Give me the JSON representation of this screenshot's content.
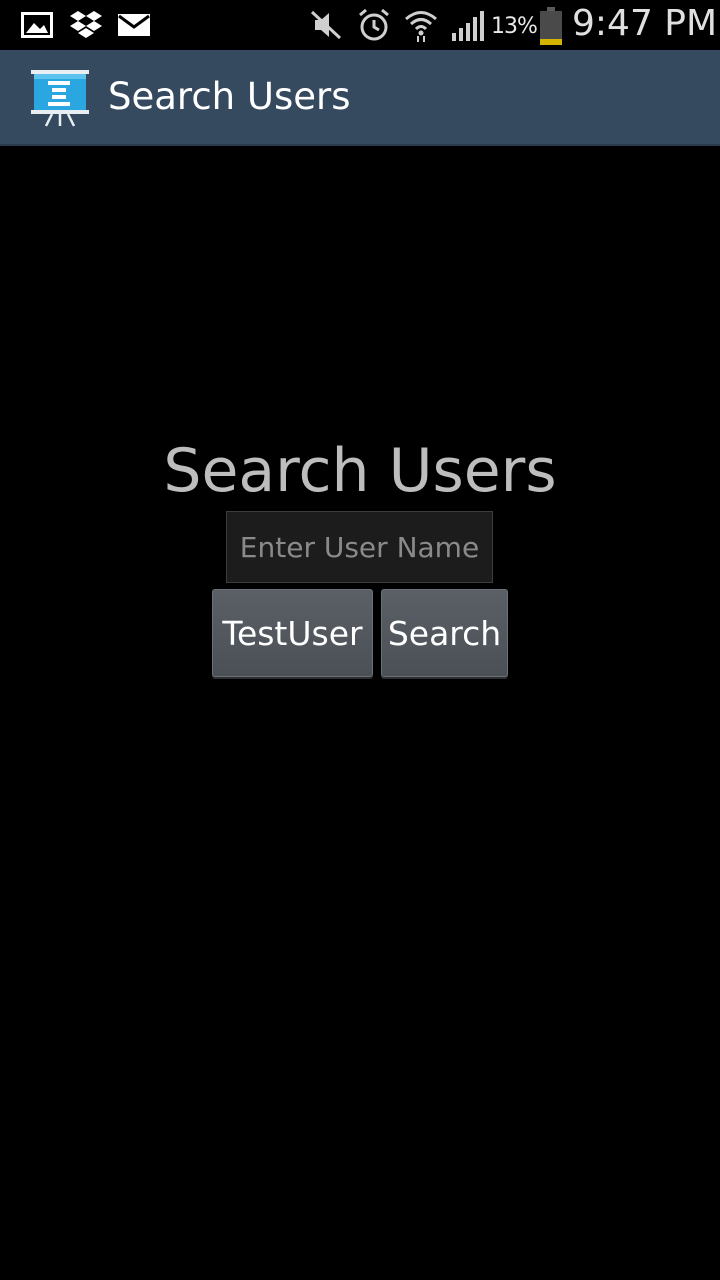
{
  "status_bar": {
    "icons_left": [
      "gallery-icon",
      "dropbox-icon",
      "mail-icon"
    ],
    "icons_right": [
      "mute-icon",
      "alarm-icon",
      "wifi-icon",
      "signal-icon",
      "battery-icon"
    ],
    "battery_percent": "13%",
    "time": "9:47 PM",
    "battery_color": "#d4b400"
  },
  "action_bar": {
    "title": "Search Users",
    "background": "#35495f",
    "icon": "presentation-board-icon"
  },
  "main": {
    "heading": "Search Users",
    "input": {
      "placeholder": "Enter User Name",
      "value": ""
    },
    "buttons": {
      "test_user_label": "TestUser",
      "search_label": "Search"
    }
  }
}
